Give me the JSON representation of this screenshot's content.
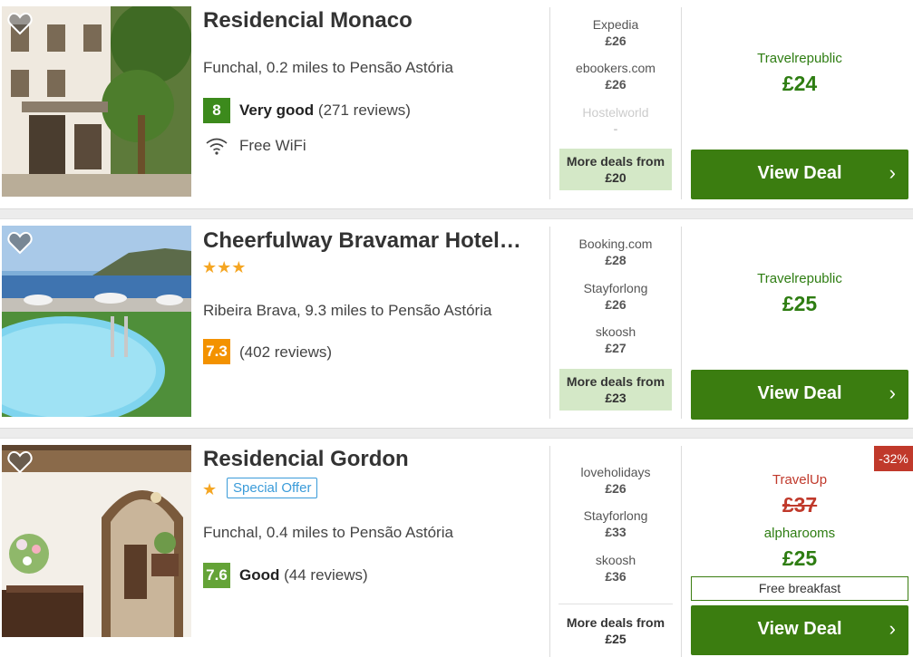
{
  "hotels": [
    {
      "name": "Residencial Monaco",
      "stars": "",
      "location": "Funchal, 0.2 miles to Pensão Astória",
      "rating_score": "8",
      "rating_word": "Very good",
      "rating_reviews": "(271 reviews)",
      "amenity": "Free WiFi",
      "providers": [
        {
          "name": "Expedia",
          "price": "£26"
        },
        {
          "name": "ebookers.com",
          "price": "£26"
        },
        {
          "name": "Hostelworld",
          "price": "-"
        }
      ],
      "more_deals": "More deals from £20",
      "best_provider": "Travelrepublic",
      "best_price": "£24",
      "view_deal": "View Deal"
    },
    {
      "name": "Cheerfulway Bravamar Hotel…",
      "stars": "★★★",
      "location": "Ribeira Brava, 9.3 miles to Pensão Astória",
      "rating_score": "7.3",
      "rating_word": "",
      "rating_reviews": "(402 reviews)",
      "providers": [
        {
          "name": "Booking.com",
          "price": "£28"
        },
        {
          "name": "Stayforlong",
          "price": "£26"
        },
        {
          "name": "skoosh",
          "price": "£27"
        }
      ],
      "more_deals": "More deals from £23",
      "best_provider": "Travelrepublic",
      "best_price": "£25",
      "view_deal": "View Deal"
    },
    {
      "name": "Residencial Gordon",
      "stars": "★",
      "special_offer": "Special Offer",
      "location": "Funchal, 0.4 miles to Pensão Astória",
      "rating_score": "7.6",
      "rating_word": "Good",
      "rating_reviews": "(44 reviews)",
      "providers": [
        {
          "name": "loveholidays",
          "price": "£26"
        },
        {
          "name": "Stayforlong",
          "price": "£33"
        },
        {
          "name": "skoosh",
          "price": "£36"
        }
      ],
      "more_deals": "More deals from",
      "more_deals_price": "£25",
      "discount": "-32%",
      "strike_provider": "TravelUp",
      "strike_price": "£37",
      "best_provider": "alpharooms",
      "best_price": "£25",
      "free_breakfast": "Free breakfast",
      "view_deal": "View Deal"
    }
  ],
  "colors": {
    "accent_green": "#3b7d10",
    "price_green": "#2e7d12",
    "star_gold": "#f5a623",
    "discount_red": "#c0392b",
    "more_deals_bg": "#d4e8c7"
  }
}
